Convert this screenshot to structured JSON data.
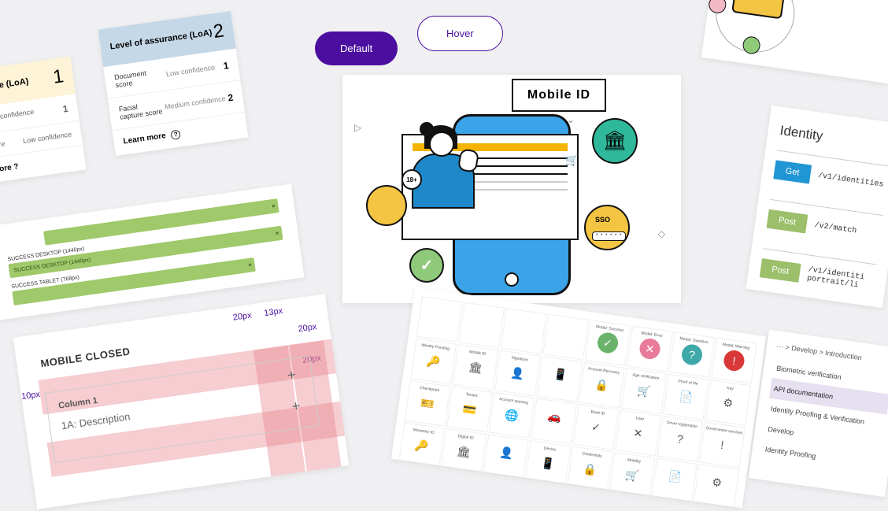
{
  "loa1": {
    "header": "rance (LoA)",
    "score": "1",
    "row1_conf": "Low confidence",
    "row1_score": "1",
    "row2_label": "pture",
    "row2_conf": "Low confidence",
    "learn": "more"
  },
  "loa2": {
    "header": "Level of assurance (LoA)",
    "score": "2",
    "row1_label": "Document score",
    "row1_conf": "Low confidence",
    "row1_score": "1",
    "row2_label": "Facial capture score",
    "row2_conf": "Medium confidence",
    "row2_score": "2",
    "learn": "Learn more"
  },
  "buttons": {
    "default": "Default",
    "hover": "Hover"
  },
  "mobile": {
    "title": "Mobile ID",
    "age": "18+",
    "sso": "SSO",
    "pw": "* * * * * *"
  },
  "bp": {
    "l1": "SUCCESS DESKTOP (1440px)",
    "l2": "SUCCESS DESKTOP (1440px)",
    "l3": "SUCCESS TABLET (768px)"
  },
  "spec": {
    "title": "MOBILE CLOSED",
    "d1": "20px",
    "d2": "13px",
    "d3": "20px",
    "d4": "20px",
    "d5": "10px",
    "col": "Column 1",
    "desc": "1A: Description"
  },
  "grid": {
    "h": [
      "",
      "Modal: Success",
      "Modal: Error",
      "Modal: Question",
      "Modal: Warning"
    ],
    "labels": [
      "Identity Proofing",
      "Mobile ID",
      "Signature",
      "",
      "Account Recovery",
      "Age verification",
      "Proof of life",
      "Key",
      "Checkpoint",
      "Tenant",
      "Account opening",
      "",
      "Bank ID",
      "User",
      "Driver registration",
      "Government services",
      "Monetary ID",
      "Digital ID",
      "",
      "Device",
      "Credentials",
      "Mobility"
    ]
  },
  "api": {
    "title": "Identity",
    "rows": [
      {
        "method": "Get",
        "path": "/v1/identities"
      },
      {
        "method": "Post",
        "path": "/v2/match"
      },
      {
        "method": "Post",
        "path": "/v1/identiti\nportrait/li"
      }
    ]
  },
  "nav": {
    "bc": "··· > Develop > Introduction",
    "items": [
      "Biometric verification",
      "API documentation",
      "Identity Proofing & Verification",
      "Develop",
      "Identity Proofing"
    ],
    "active": 1
  }
}
